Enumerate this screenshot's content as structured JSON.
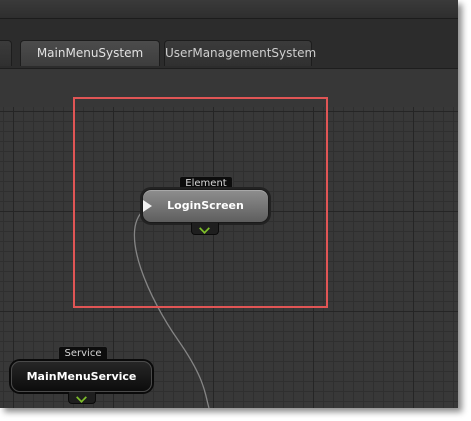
{
  "tabs": [
    {
      "label": "",
      "active": false
    },
    {
      "label": "MainMenuSystem",
      "active": true
    },
    {
      "label": "UserManagementSystem",
      "active": false
    }
  ],
  "nodes": {
    "element": {
      "type_label": "Element",
      "name": "LoginScreen"
    },
    "service": {
      "type_label": "Service",
      "name": "MainMenuService"
    }
  },
  "colors": {
    "selection_border": "#e05555",
    "port_chevron": "#7fc02a",
    "canvas": "#383838"
  }
}
